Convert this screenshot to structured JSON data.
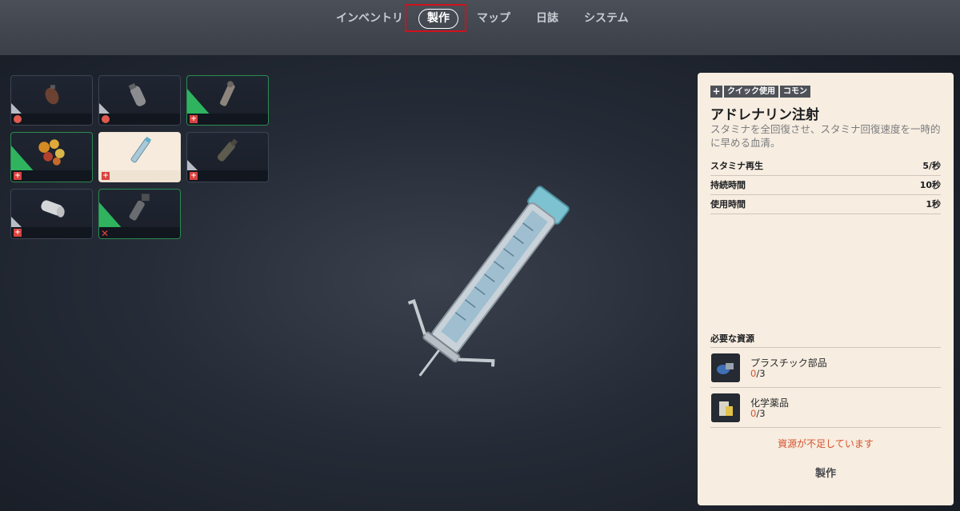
{
  "tabs": [
    {
      "label": "インベントリ"
    },
    {
      "label": "製作"
    },
    {
      "label": "マップ"
    },
    {
      "label": "日誌"
    },
    {
      "label": "システム"
    }
  ],
  "inventory": {
    "slots": [
      {
        "item": "grenade-icon",
        "badge": "pill"
      },
      {
        "item": "canister-icon",
        "badge": "pill"
      },
      {
        "item": "injector-icon",
        "badge": "medical"
      },
      {
        "item": "fruit-icon",
        "badge": "medical"
      },
      {
        "item": "adrenaline-syringe-icon",
        "badge": "medical"
      },
      {
        "item": "bottle-icon",
        "badge": "medical"
      },
      {
        "item": "bandage-icon",
        "badge": "medical"
      },
      {
        "item": "device-icon",
        "badge": "cross"
      }
    ]
  },
  "detail": {
    "tags": [
      "クイック使用",
      "コモン"
    ],
    "title": "アドレナリン注射",
    "description": "スタミナを全回復させ、スタミナ回復速度を一時的に早める血清。",
    "stats": [
      {
        "label": "スタミナ再生",
        "value": "5/秒"
      },
      {
        "label": "持続時間",
        "value": "10秒"
      },
      {
        "label": "使用時間",
        "value": "1秒"
      }
    ],
    "requirements_title": "必要な資源",
    "requirements": [
      {
        "name": "プラスチック部品",
        "have": "0",
        "need": "/3"
      },
      {
        "name": "化学薬品",
        "have": "0",
        "need": "/3"
      }
    ],
    "warning": "資源が不足しています",
    "craft_label": "製作"
  },
  "colors": {
    "accent_red": "#d0121b",
    "rarity_green": "#2fb35f",
    "panel_bg": "#f7ede0",
    "warning": "#d4532f"
  }
}
